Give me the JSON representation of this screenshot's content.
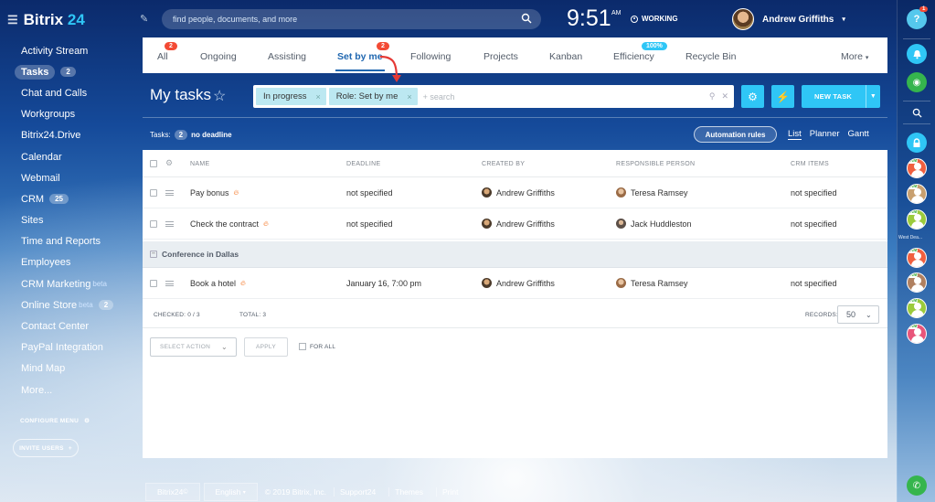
{
  "app": {
    "name": "Bitrix",
    "name_suffix": "24"
  },
  "sidebar": {
    "items": [
      {
        "label": "Activity Stream"
      },
      {
        "label": "Tasks",
        "count": "2",
        "active": true
      },
      {
        "label": "Chat and Calls"
      },
      {
        "label": "Workgroups"
      },
      {
        "label": "Bitrix24.Drive"
      },
      {
        "label": "Calendar"
      },
      {
        "label": "Webmail"
      },
      {
        "label": "CRM",
        "count": "25"
      },
      {
        "label": "Sites"
      },
      {
        "label": "Time and Reports"
      },
      {
        "label": "Employees"
      },
      {
        "label": "CRM Marketing",
        "sup": "beta"
      },
      {
        "label": "Online Store",
        "sup": "beta",
        "count": "2"
      },
      {
        "label": "Contact Center"
      },
      {
        "label": "PayPal Integration"
      },
      {
        "label": "Mind Map"
      },
      {
        "label": "More..."
      }
    ],
    "configure_menu": "CONFIGURE MENU",
    "invite_users": "INVITE USERS"
  },
  "header": {
    "search_placeholder": "find people, documents, and more",
    "time": "9:51",
    "ampm": "AM",
    "status": "WORKING",
    "user_name": "Andrew Griffiths"
  },
  "right_bar": {
    "help_badge": "1",
    "contact_label": "West Dea..."
  },
  "tabs": [
    {
      "label": "All",
      "badge": "2"
    },
    {
      "label": "Ongoing"
    },
    {
      "label": "Assisting"
    },
    {
      "label": "Set by me",
      "badge": "2",
      "active": true
    },
    {
      "label": "Following"
    },
    {
      "label": "Projects"
    },
    {
      "label": "Kanban"
    },
    {
      "label": "Efficiency",
      "badge": "100%",
      "badge_color": "#2fc6f6"
    },
    {
      "label": "Recycle Bin"
    },
    {
      "label": "More"
    }
  ],
  "page": {
    "title": "My tasks",
    "filter_chips": [
      "In progress",
      "Role: Set by me"
    ],
    "filter_placeholder": "+ search",
    "new_task": "NEW TASK",
    "tasks_label": "Tasks:",
    "tasks_count": "2",
    "tasks_note": "no deadline",
    "automation_rules": "Automation rules",
    "views": [
      "List",
      "Planner",
      "Gantt"
    ]
  },
  "grid": {
    "columns": [
      "NAME",
      "DEADLINE",
      "CREATED BY",
      "RESPONSIBLE PERSON",
      "CRM ITEMS"
    ],
    "rows": [
      {
        "name": "Pay bonus",
        "deadline": "not specified",
        "created_by": "Andrew Griffiths",
        "responsible": "Teresa Ramsey",
        "crm": "not specified"
      },
      {
        "name": "Check the contract",
        "deadline": "not specified",
        "created_by": "Andrew Griffiths",
        "responsible": "Jack Huddleston",
        "crm": "not specified"
      }
    ],
    "group": {
      "label": "Conference in Dallas",
      "rows": [
        {
          "name": "Book a hotel",
          "deadline": "January 16, 7:00 pm",
          "created_by": "Andrew Griffiths",
          "responsible": "Teresa Ramsey",
          "crm": "not specified"
        }
      ]
    },
    "footer": {
      "checked": "CHECKED: 0 / 3",
      "total": "TOTAL: 3",
      "records_label": "RECORDS:",
      "records_value": "50"
    },
    "actions": {
      "select_action": "SELECT ACTION",
      "apply": "APPLY",
      "for_all": "FOR ALL"
    }
  },
  "footer": {
    "brand": "Bitrix24",
    "language": "English",
    "copyright": "© 2019 Bitrix, Inc.",
    "links": [
      "Support24",
      "Themes",
      "Print"
    ]
  },
  "colors": {
    "accent": "#2fc6f6",
    "active_tab": "#2067b0",
    "badge_red": "#f34a34",
    "fire": "#f47320"
  }
}
